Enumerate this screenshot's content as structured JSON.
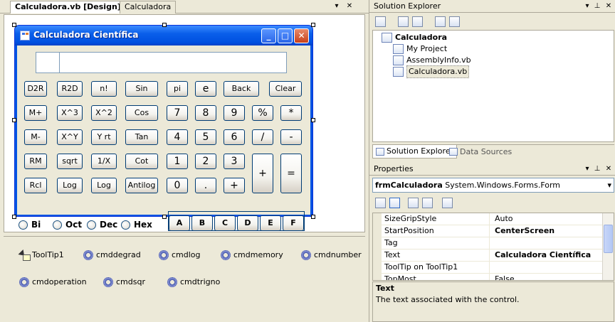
{
  "document_tabs": [
    {
      "label": "Calculadora.vb [Design]*"
    },
    {
      "label": "Calculadora"
    }
  ],
  "form": {
    "title": "Calculadora Científica",
    "buttons": [
      {
        "label": "D2R"
      },
      {
        "label": "R2D"
      },
      {
        "label": "n!"
      },
      {
        "label": "Sin"
      },
      {
        "label": "pi"
      },
      {
        "label": "e"
      },
      {
        "label": "Back"
      },
      {
        "label": "Clear"
      },
      {
        "label": "M+"
      },
      {
        "label": "X^3"
      },
      {
        "label": "X^2"
      },
      {
        "label": "Cos"
      },
      {
        "label": "7"
      },
      {
        "label": "8"
      },
      {
        "label": "9"
      },
      {
        "label": "%"
      },
      {
        "label": "*"
      },
      {
        "label": "M-"
      },
      {
        "label": "X^Y"
      },
      {
        "label": "Y rt"
      },
      {
        "label": "Tan"
      },
      {
        "label": "4"
      },
      {
        "label": "5"
      },
      {
        "label": "6"
      },
      {
        "label": "/"
      },
      {
        "label": "-"
      },
      {
        "label": "RM"
      },
      {
        "label": "sqrt"
      },
      {
        "label": "1/X"
      },
      {
        "label": "Cot"
      },
      {
        "label": "1"
      },
      {
        "label": "2"
      },
      {
        "label": "3"
      },
      {
        "label": "+"
      },
      {
        "label": "="
      },
      {
        "label": "Rcl"
      },
      {
        "label": "Log"
      },
      {
        "label": "Log"
      },
      {
        "label": "Antilog"
      },
      {
        "label": "0"
      },
      {
        "label": "."
      },
      {
        "label": "+"
      }
    ],
    "radios": [
      {
        "label": "Bi"
      },
      {
        "label": "Oct"
      },
      {
        "label": "Dec"
      },
      {
        "label": "Hex"
      }
    ],
    "hex_buttons": [
      {
        "label": "A"
      },
      {
        "label": "B"
      },
      {
        "label": "C"
      },
      {
        "label": "D"
      },
      {
        "label": "E"
      },
      {
        "label": "F"
      }
    ]
  },
  "component_tray": [
    {
      "label": "ToolTip1",
      "icon": "tooltip-icon"
    },
    {
      "label": "cmddegrad",
      "icon": "component-icon"
    },
    {
      "label": "cmdlog",
      "icon": "component-icon"
    },
    {
      "label": "cmdmemory",
      "icon": "component-icon"
    },
    {
      "label": "cmdnumber",
      "icon": "component-icon"
    },
    {
      "label": "cmdoperation",
      "icon": "component-icon"
    },
    {
      "label": "cmdsqr",
      "icon": "component-icon"
    },
    {
      "label": "cmdtrigno",
      "icon": "component-icon"
    }
  ],
  "solution_explorer": {
    "title": "Solution Explorer",
    "tree": [
      {
        "label": "Calculadora",
        "icon": "project-icon"
      },
      {
        "label": "My Project",
        "icon": "my-project-icon"
      },
      {
        "label": "AssemblyInfo.vb",
        "icon": "vb-file-icon"
      },
      {
        "label": "Calculadora.vb",
        "icon": "form-file-icon"
      }
    ],
    "tabs": [
      {
        "label": "Solution Explorer"
      },
      {
        "label": "Data Sources"
      }
    ]
  },
  "properties": {
    "title": "Properties",
    "object_name": "frmCalculadora",
    "object_type": "System.Windows.Forms.Form",
    "rows": [
      {
        "name": "SizeGripStyle",
        "value": "Auto",
        "bold": false
      },
      {
        "name": "StartPosition",
        "value": "CenterScreen",
        "bold": true
      },
      {
        "name": "Tag",
        "value": "",
        "bold": false
      },
      {
        "name": "Text",
        "value": "Calculadora Científica",
        "bold": true
      },
      {
        "name": "ToolTip on ToolTip1",
        "value": "",
        "bold": false
      },
      {
        "name": "TopMost",
        "value": "False",
        "bold": false
      }
    ],
    "description_title": "Text",
    "description_text": "The text associated with the control."
  },
  "colors": {
    "titlebar": "#0054E3",
    "background": "#ECE9D8",
    "selection": "#316AC5"
  }
}
